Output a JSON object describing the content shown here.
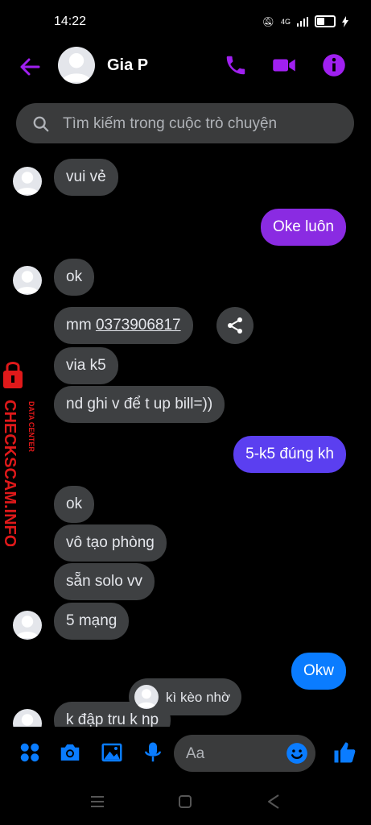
{
  "status_bar": {
    "time": "14:22",
    "network": "4G"
  },
  "header": {
    "contact_name": "Gia P"
  },
  "search": {
    "placeholder": "Tìm kiếm trong cuộc trò chuyện"
  },
  "messages": [
    {
      "dir": "in",
      "text": "vui vẻ"
    },
    {
      "dir": "out",
      "text": "Oke luôn"
    },
    {
      "dir": "in",
      "text": "ok"
    },
    {
      "dir": "in",
      "text_prefix": "mm ",
      "phone": "0373906817"
    },
    {
      "dir": "in",
      "text": "via k5"
    },
    {
      "dir": "in",
      "text": "nd ghi v để t up bill=))"
    },
    {
      "dir": "out",
      "text": "5-k5 đúng kh"
    },
    {
      "dir": "in",
      "text": "ok"
    },
    {
      "dir": "in",
      "text": "vô tạo phòng"
    },
    {
      "dir": "in",
      "text": "sẵn solo vv"
    },
    {
      "dir": "in",
      "text": "5 mạng"
    },
    {
      "dir": "out",
      "text": "Okw"
    },
    {
      "dir": "in",
      "text": "k đập tru k hp"
    }
  ],
  "reaction_chip": {
    "text": "kì kèo nhờ"
  },
  "composer": {
    "placeholder": "Aa"
  },
  "watermark": {
    "line1": "DATA CENTER",
    "line2": "CHECKSCAM.INFO"
  },
  "colors": {
    "accent": "#a020f0",
    "in_bubble": "#3e4042",
    "out_purple": "#8a2be2",
    "out_indigo": "#5b3ff0",
    "out_blue": "#0a7cff",
    "composer_icon": "#0a7cff",
    "watermark": "#e0191a"
  }
}
